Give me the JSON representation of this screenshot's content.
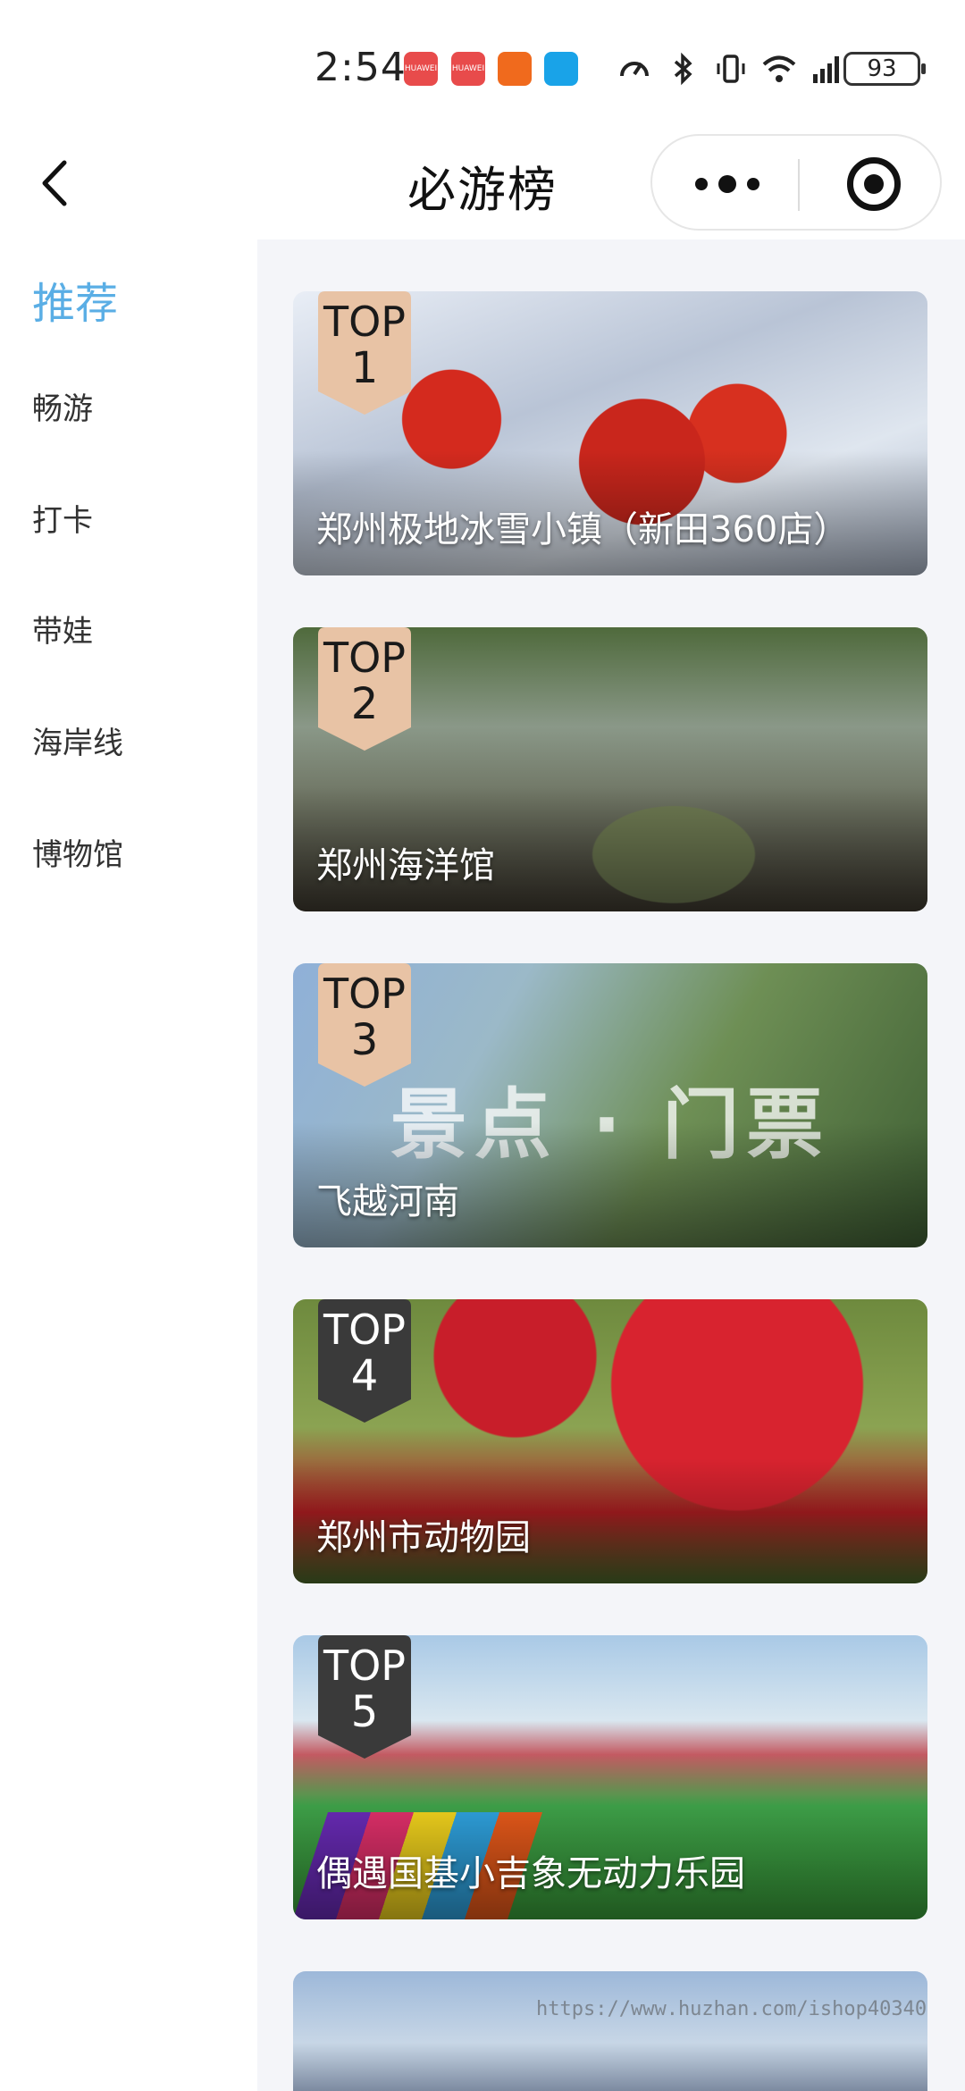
{
  "status_bar": {
    "time": "2:54",
    "battery": "93",
    "notifications": [
      "huawei-app-icon",
      "huawei-app-icon",
      "kuaishou-app-icon",
      "message-app-icon"
    ],
    "icons": [
      "speed-icon",
      "bluetooth-icon",
      "vibrate-icon",
      "wifi-icon",
      "5g-signal-icon"
    ]
  },
  "nav": {
    "title": "必游榜"
  },
  "sidebar": {
    "items": [
      {
        "label": "推荐",
        "active": true
      },
      {
        "label": "畅游",
        "active": false
      },
      {
        "label": "打卡",
        "active": false
      },
      {
        "label": "带娃",
        "active": false
      },
      {
        "label": "海岸线",
        "active": false
      },
      {
        "label": "博物馆",
        "active": false
      }
    ]
  },
  "cards": [
    {
      "badge_top": "TOP",
      "rank": "1",
      "title": "郑州极地冰雪小镇（新田360店）"
    },
    {
      "badge_top": "TOP",
      "rank": "2",
      "title": "郑州海洋馆"
    },
    {
      "badge_top": "TOP",
      "rank": "3",
      "title": "飞越河南",
      "image_text": "景点 · 门票"
    },
    {
      "badge_top": "TOP",
      "rank": "4",
      "title": "郑州市动物园"
    },
    {
      "badge_top": "TOP",
      "rank": "5",
      "title": "偶遇国基小吉象无动力乐园"
    }
  ],
  "colors": {
    "accent": "#5aaee5",
    "badge_gold": "#e8c3a5",
    "badge_dark": "#3a3a3a",
    "content_bg": "#f4f5f9"
  },
  "watermark": "https://www.huzhan.com/ishop40340"
}
